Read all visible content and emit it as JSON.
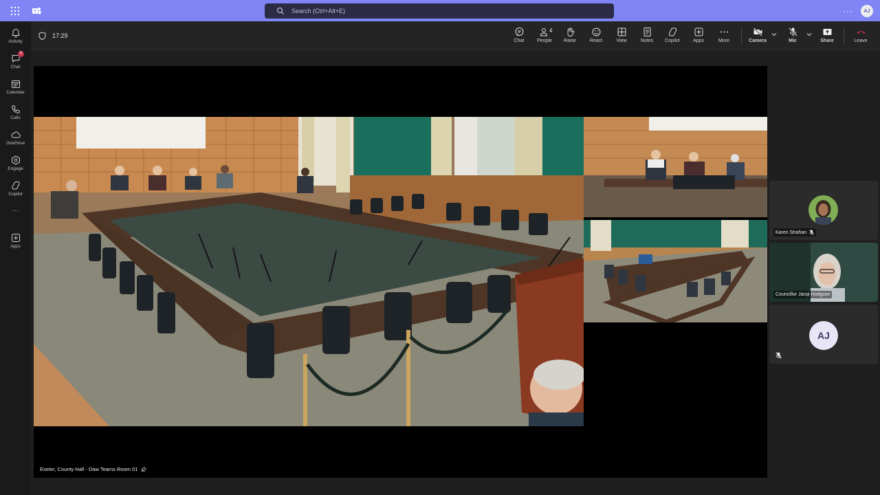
{
  "topbar": {
    "search_placeholder": "Search (Ctrl+Alt+E)",
    "more": "···",
    "profile_initials": "AJ",
    "accent": "#7f85f5"
  },
  "rail": {
    "items": [
      {
        "label": "Activity",
        "icon": "bell-icon"
      },
      {
        "label": "Chat",
        "icon": "chat-icon",
        "badge": "5"
      },
      {
        "label": "Calendar",
        "icon": "calendar-icon"
      },
      {
        "label": "Calls",
        "icon": "phone-icon"
      },
      {
        "label": "OneDrive",
        "icon": "cloud-icon"
      },
      {
        "label": "Engage",
        "icon": "engage-icon"
      },
      {
        "label": "Copilot",
        "icon": "copilot-icon"
      },
      {
        "label": "···",
        "icon": "more-icon"
      },
      {
        "label": "Apps",
        "icon": "apps-icon"
      }
    ]
  },
  "meeting": {
    "time": "17:29",
    "toolbar": {
      "chat": "Chat",
      "people": "People",
      "people_count": "4",
      "raise": "Raise",
      "react": "React",
      "view": "View",
      "notes": "Notes",
      "copilot": "Copilot",
      "apps": "Apps",
      "more": "More",
      "camera": "Camera",
      "mic": "Mic",
      "share": "Share",
      "leave": "Leave"
    },
    "leave_color": "#c4314b",
    "room_label": "Exeter, County Hall - Daw Teams Room 01"
  },
  "participants": [
    {
      "name": "Karen Strahan",
      "muted": true
    },
    {
      "name": "Councillor Jacqi Hodgson",
      "muted": false
    },
    {
      "initials": "AJ",
      "muted": true
    }
  ]
}
